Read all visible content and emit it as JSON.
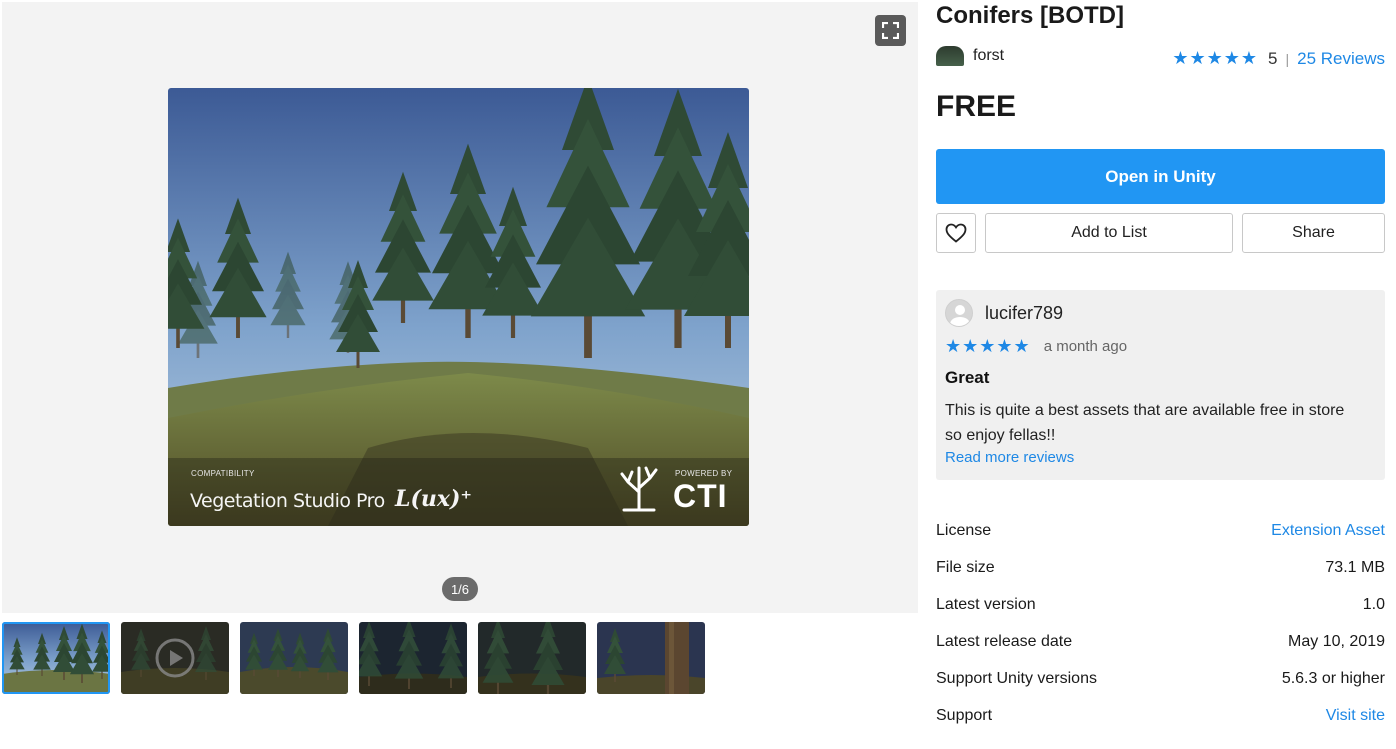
{
  "gallery": {
    "main_image": {
      "compatibility_label": "COMPATIBILITY",
      "vsp_text": "Vegetation Studio Pro",
      "lux_text": "L(ux)⁺",
      "powered_by_label": "POWERED BY",
      "cti_text": "CTI"
    },
    "page_indicator": "1/6",
    "fullscreen_icon": "fullscreen-icon",
    "thumbnail_count": 6
  },
  "product": {
    "title": "Conifers [BOTD]",
    "publisher": "forst",
    "rating_stars": "★★★★★",
    "rating_value": "5",
    "rating_separator": "|",
    "reviews_link": "25 Reviews",
    "price": "FREE"
  },
  "actions": {
    "open_in_unity": "Open in Unity",
    "favorite_icon": "heart-icon",
    "add_to_list": "Add to List",
    "share": "Share"
  },
  "review": {
    "username": "lucifer789",
    "stars": "★★★★★",
    "time": "a month ago",
    "title": "Great",
    "body": "This is quite a best assets that are available free in store so enjoy fellas!!",
    "read_more": "Read more reviews"
  },
  "details": [
    {
      "label": "License",
      "value": "Extension Asset",
      "link": true
    },
    {
      "label": "File size",
      "value": "73.1 MB",
      "link": false
    },
    {
      "label": "Latest version",
      "value": "1.0",
      "link": false
    },
    {
      "label": "Latest release date",
      "value": "May 10, 2019",
      "link": false
    },
    {
      "label": "Support Unity versions",
      "value": "5.6.3 or higher",
      "link": false
    },
    {
      "label": "Support",
      "value": "Visit site",
      "link": true
    }
  ],
  "colors": {
    "accent": "#2196f3",
    "link": "#1e88e5",
    "gallery_bg": "#f3f3f3",
    "review_bg": "#f0f0f0"
  }
}
